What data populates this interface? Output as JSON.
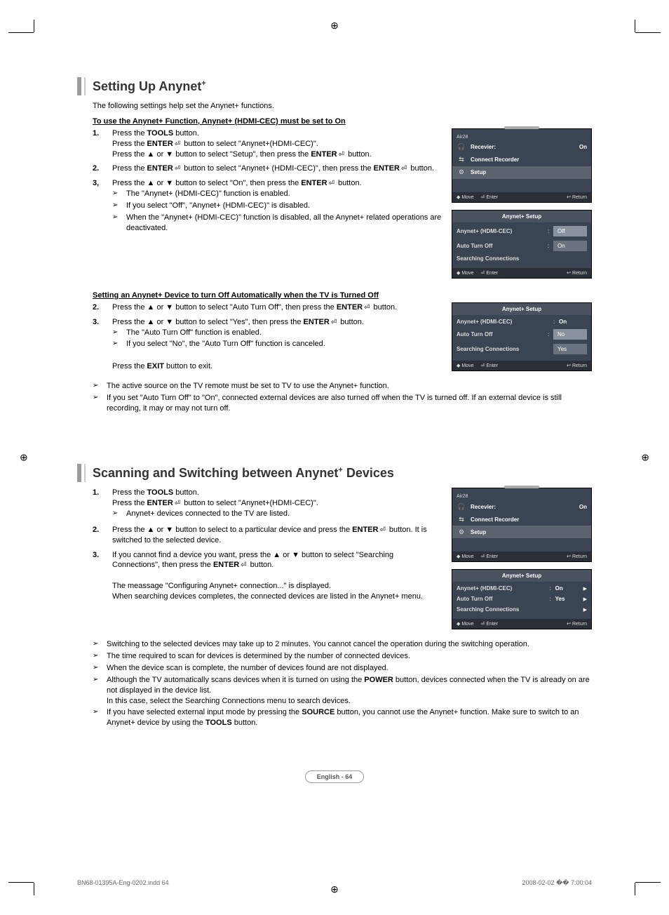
{
  "section1": {
    "title_a": "Setting Up Anynet",
    "title_sup": "+",
    "intro": "The following settings help set the Anynet+ functions.",
    "sub1": "To use the Anynet+ Function, Anynet+ (HDMI-CEC) must be set to On",
    "step1_num": "1.",
    "step1_a": "Press the ",
    "step1_b": "TOOLS",
    "step1_c": " button.",
    "step1_l2a": "Press the ",
    "step1_l2b": "ENTER",
    "step1_l2c": " button to select \"Anynet+(HDMI-CEC)\".",
    "step1_l3a": "Press the ▲ or ▼ button to select \"Setup\", then press the ",
    "step1_l3b": "ENTER",
    "step1_l3c": " button.",
    "step2_num": "2.",
    "step2_a": "Press the ",
    "step2_b": "ENTER",
    "step2_c": " button to select \"Anynet+ (HDMI-CEC)\", then press the ",
    "step2_d": "ENTER",
    "step2_e": " button.",
    "step3_num": "3,",
    "step3_a": "Press the ▲ or ▼ button to select \"On\", then press the ",
    "step3_b": "ENTER",
    "step3_c": " button.",
    "bullet3_1": "The \"Anynet+ (HDMI-CEC)\" function is enabled.",
    "bullet3_2": "If you select \"Off\", \"Anynet+ (HDMI-CEC)\" is disabled.",
    "bullet3_3": "When the \"Anynet+ (HDMI-CEC)\" function is disabled, all the Anynet+ related operations are deactivated.",
    "sub2": "Setting an Anynet+ Device to turn Off Automatically when the TV is Turned Off",
    "step2b_num": "2.",
    "step2b_a": "Press the ▲ or ▼ button to select \"Auto Turn Off\", then press the ",
    "step2b_b": "ENTER",
    "step2b_c": " button.",
    "step3b_num": "3.",
    "step3b_a": "Press the ▲ or ▼ button to select \"Yes\", then press the ",
    "step3b_b": "ENTER",
    "step3b_c": " button.",
    "bullet3b_1": "The \"Auto Turn Off\" function is enabled.",
    "bullet3b_2": "If you select \"No\", the \"Auto Turn Off\" function is canceled.",
    "exit_a": "Press the ",
    "exit_b": "EXIT",
    "exit_c": " button to exit.",
    "note1": "The active source on the TV remote must be set to TV to use the Anynet+ function.",
    "note2": "If you set \"Auto Turn Off\" to \"On\", connected external devices are also turned off when the TV is turned off. If an external device is still recording, it may or may not turn off."
  },
  "section2": {
    "title_a": "Scanning and Switching between Anynet",
    "title_sup": "+",
    "title_b": " Devices",
    "step1_num": "1.",
    "step1_a": "Press the ",
    "step1_b": "TOOLS",
    "step1_c": " button.",
    "step1_l2a": "Press the ",
    "step1_l2b": "ENTER",
    "step1_l2c": " button to select \"Anynet+(HDMI-CEC)\".",
    "bullet1_1": "Anynet+ devices connected to the TV are listed.",
    "step2_num": "2.",
    "step2_a": "Press the ▲ or ▼ button to select to a particular device and press the ",
    "step2_b": "ENTER",
    "step2_c": " button. It is switched to the selected device.",
    "step3_num": "3.",
    "step3_a": "If you cannot find a device you want, press the ▲ or ▼ button to select \"Searching Connections\", then press the ",
    "step3_b": "ENTER",
    "step3_c": " button.",
    "step3_msg1": "The meassage \"Configuring Anynet+ connection...\" is displayed.",
    "step3_msg2": "When searching devices completes, the connected devices are listed in the Anynet+ menu.",
    "note1": "Switching to the selected devices may take up to 2 minutes. You cannot cancel the operation during the switching operation.",
    "note2": "The time required to scan for devices is determined by the number of connected devices.",
    "note3": "When the device scan is complete, the number of devices found are not displayed.",
    "note4a": "Although the TV automatically scans devices when it is turned on using the ",
    "note4b": "POWER",
    "note4c": " button, devices connected when the TV is already on are not displayed in the device list.",
    "note4d": "In this case, select the Searching Connections menu to search devices.",
    "note5a": "If you have selected external input mode by pressing the ",
    "note5b": "SOURCE",
    "note5c": " button, you cannot use the Anynet+ function. Make sure to switch to an Anynet+ device by using the ",
    "note5d": "TOOLS",
    "note5e": " button."
  },
  "osd": {
    "air": "Air28",
    "recv_lbl": "Recevier:",
    "recv_val": "On",
    "connect": "Connect Recorder",
    "setup": "Setup",
    "anynet_setup": "Anynet+ Setup",
    "hdmi_cec": "Anynet+ (HDMI-CEC)",
    "auto_off": "Auto Turn Off",
    "search_con": "Searching Connections",
    "off": "Off",
    "on": "On",
    "no": "No",
    "yes": "Yes",
    "move": "Move",
    "enter": "Enter",
    "return": "Return"
  },
  "page_label": "English - 64",
  "footer_left": "BN68-01395A-Eng-0202.indd   64",
  "footer_right": "2008-02-02   �� 7:00:04"
}
